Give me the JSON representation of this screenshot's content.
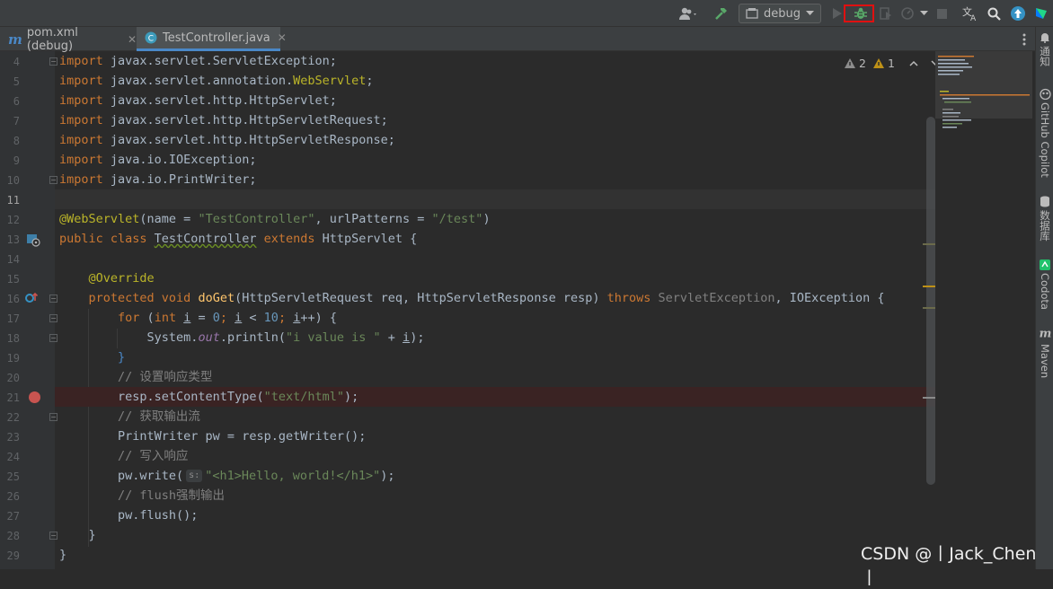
{
  "toolbar": {
    "run_config": "debug",
    "colors": {
      "debug_highlight": "#e01010",
      "build": "#59a869",
      "debug": "#59a869"
    }
  },
  "tabs": [
    {
      "label": "pom.xml (debug)",
      "icon": "maven-icon"
    },
    {
      "label": "TestController.java",
      "icon": "java-class-icon"
    }
  ],
  "inspections": {
    "warnings": "2",
    "weak_warnings": "1"
  },
  "lines": [
    {
      "n": "4"
    },
    {
      "n": "5"
    },
    {
      "n": "6"
    },
    {
      "n": "7"
    },
    {
      "n": "8"
    },
    {
      "n": "9"
    },
    {
      "n": "10"
    },
    {
      "n": "11"
    },
    {
      "n": "12"
    },
    {
      "n": "13"
    },
    {
      "n": "14"
    },
    {
      "n": "15"
    },
    {
      "n": "16"
    },
    {
      "n": "17"
    },
    {
      "n": "18"
    },
    {
      "n": "19"
    },
    {
      "n": "20"
    },
    {
      "n": "21"
    },
    {
      "n": "22"
    },
    {
      "n": "23"
    },
    {
      "n": "24"
    },
    {
      "n": "25"
    },
    {
      "n": "26"
    },
    {
      "n": "27"
    },
    {
      "n": "28"
    },
    {
      "n": "29"
    }
  ],
  "code": {
    "l4_a": "import",
    "l4_b": " javax.servlet.ServletException;",
    "l5_a": "import",
    "l5_b": " javax.servlet.annotation.",
    "l5_c": "WebServlet",
    "l5_d": ";",
    "l6_a": "import",
    "l6_b": " javax.servlet.http.HttpServlet;",
    "l7_a": "import",
    "l7_b": " javax.servlet.http.HttpServletRequest;",
    "l8_a": "import",
    "l8_b": " javax.servlet.http.HttpServletResponse;",
    "l9_a": "import",
    "l9_b": " java.io.IOException;",
    "l10_a": "import",
    "l10_b": " java.io.PrintWriter;",
    "l12_a": "@WebServlet",
    "l12_b": "(name = ",
    "l12_c": "\"TestController\"",
    "l12_d": ", urlPatterns = ",
    "l12_e": "\"/test\"",
    "l12_f": ")",
    "l13_a": "public class ",
    "l13_b": "TestController",
    "l13_c": " extends ",
    "l13_d": "HttpServlet {",
    "l15_a": "    @Override",
    "l16_a": "    protected void ",
    "l16_b": "doGet",
    "l16_c": "(HttpServletRequest req, HttpServletResponse resp) ",
    "l16_d": "throws ",
    "l16_e": "ServletException",
    "l16_f": ", IOException {",
    "l17_a": "        for ",
    "l17_b": "(",
    "l17_c": "int ",
    "l17_d": "i",
    "l17_e": " = ",
    "l17_f": "0",
    "l17_g": "; ",
    "l17_h": "i",
    "l17_i": " < ",
    "l17_j": "10",
    "l17_k": "; ",
    "l17_l": "i",
    "l17_m": "++) {",
    "l18_a": "            System.",
    "l18_b": "out",
    "l18_c": ".println(",
    "l18_d": "\"i value is \"",
    "l18_e": " + ",
    "l18_f": "i",
    "l18_g": ");",
    "l19_a": "        }",
    "l20_a": "        // 设置响应类型",
    "l21_a": "        resp.setContentType(",
    "l21_b": "\"text/html\"",
    "l21_c": ");",
    "l22_a": "        // 获取输出流",
    "l23_a": "        PrintWriter pw = resp.getWriter();",
    "l24_a": "        // 写入响应",
    "l25_a": "        pw.write(",
    "l25_hint": "s:",
    "l25_b": "\"<h1>Hello, world!</h1>\"",
    "l25_c": ");",
    "l26_a": "        // flush强制输出",
    "l27_a": "        pw.flush();",
    "l28_a": "    }",
    "l29_a": "}"
  },
  "right_panel": [
    {
      "label": "通知",
      "icon": "bell-icon"
    },
    {
      "label": "GitHub Copilot",
      "icon": "copilot-icon"
    },
    {
      "label": "数据库",
      "icon": "database-icon"
    },
    {
      "label": "Codota",
      "icon": "codota-icon"
    },
    {
      "label": "Maven",
      "icon": "maven-icon"
    }
  ],
  "watermark": "CSDN @丨Jack_Chen丨"
}
